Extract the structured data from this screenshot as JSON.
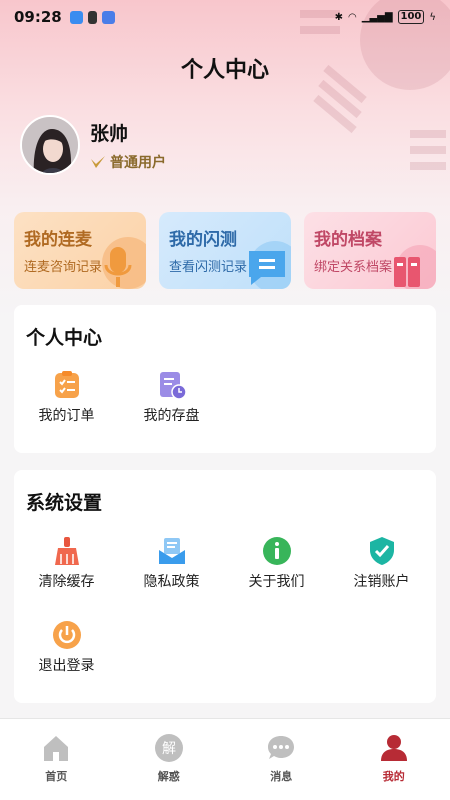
{
  "status_bar": {
    "time": "09:28",
    "battery": "100"
  },
  "header": {
    "title": "个人中心"
  },
  "profile": {
    "name": "张帅",
    "level": "普通用户"
  },
  "feature_cards": [
    {
      "title": "我的连麦",
      "subtitle": "连麦咨询记录"
    },
    {
      "title": "我的闪测",
      "subtitle": "查看闪测记录"
    },
    {
      "title": "我的档案",
      "subtitle": "绑定关系档案"
    }
  ],
  "personal_section": {
    "title": "个人中心",
    "items": [
      {
        "label": "我的订单"
      },
      {
        "label": "我的存盘"
      }
    ]
  },
  "settings_section": {
    "title": "系统设置",
    "items": [
      {
        "label": "清除缓存"
      },
      {
        "label": "隐私政策"
      },
      {
        "label": "关于我们"
      },
      {
        "label": "注销账户"
      },
      {
        "label": "退出登录"
      }
    ]
  },
  "bottom_nav": {
    "items": [
      {
        "label": "首页"
      },
      {
        "label": "解惑",
        "icon_text": "解"
      },
      {
        "label": "消息"
      },
      {
        "label": "我的"
      }
    ],
    "active_color": "#b72b35"
  }
}
